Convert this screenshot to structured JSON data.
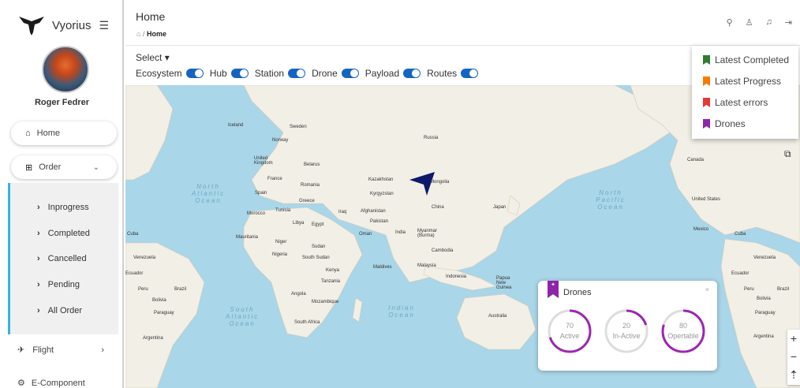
{
  "brand": {
    "name": "Vyorius",
    "menu_icon": "menu-icon"
  },
  "user": {
    "name": "Roger Fedrer"
  },
  "nav": {
    "home": "Home",
    "order": "Order",
    "order_sub": [
      "Inprogress",
      "Completed",
      "Cancelled",
      "Pending",
      "All Order"
    ],
    "flight": "Flight",
    "ecomponent": "E-Component"
  },
  "header": {
    "title": "Home",
    "breadcrumb": "Home",
    "icons": [
      "search-icon",
      "user-icon",
      "bell-icon",
      "logout-icon"
    ]
  },
  "filters": {
    "select_label": "Select",
    "toggles": [
      {
        "label": "Ecosystem",
        "on": true
      },
      {
        "label": "Hub",
        "on": true
      },
      {
        "label": "Station",
        "on": true
      },
      {
        "label": "Drone",
        "on": true
      },
      {
        "label": "Payload",
        "on": true
      },
      {
        "label": "Routes",
        "on": true
      }
    ]
  },
  "legend": [
    {
      "label": "Latest Completed",
      "color": "#2e7d32"
    },
    {
      "label": "Latest Progress",
      "color": "#f57c00"
    },
    {
      "label": "Latest errors",
      "color": "#e53935"
    },
    {
      "label": "Drones",
      "color": "#8e24aa"
    }
  ],
  "map_labels": [
    "Iceland",
    "Sweden",
    "Norway",
    "United Kingdom",
    "Belarus",
    "France",
    "Romania",
    "Spain",
    "Greece",
    "Morocco",
    "Tunisia",
    "Libya",
    "Egypt",
    "Iraq",
    "Kazakhstan",
    "Kyrgyzstan",
    "Mongolia",
    "Russia",
    "Afghanistan",
    "Pakistan",
    "China",
    "Japan",
    "India",
    "Myanmar (Burma)",
    "Oman",
    "Cambodia",
    "Mauritania",
    "Niger",
    "Sudan",
    "Nigeria",
    "South Sudan",
    "Kenya",
    "Tanzania",
    "Angola",
    "Mozambique",
    "South Africa",
    "Maldives",
    "Malaysia",
    "Indonesia",
    "Papua New Guinea",
    "Australia",
    "Canada",
    "United States",
    "Mexico",
    "Cuba",
    "Venezuela",
    "Ecuador",
    "Peru",
    "Brazil",
    "Bolivia",
    "Paraguay",
    "Argentina",
    "North Atlantic Ocean",
    "North Pacific Ocean",
    "South Atlantic Ocean",
    "Indian Ocean"
  ],
  "drones_card": {
    "title": "Drones",
    "stats": [
      {
        "value": "70",
        "label": "Active",
        "fraction": 0.7
      },
      {
        "value": "20",
        "label": "In-Active",
        "fraction": 0.2
      },
      {
        "value": "80",
        "label": "Opertable",
        "fraction": 0.8
      }
    ]
  },
  "zoom": {
    "in": "+",
    "out": "−",
    "reset": "⇡"
  }
}
